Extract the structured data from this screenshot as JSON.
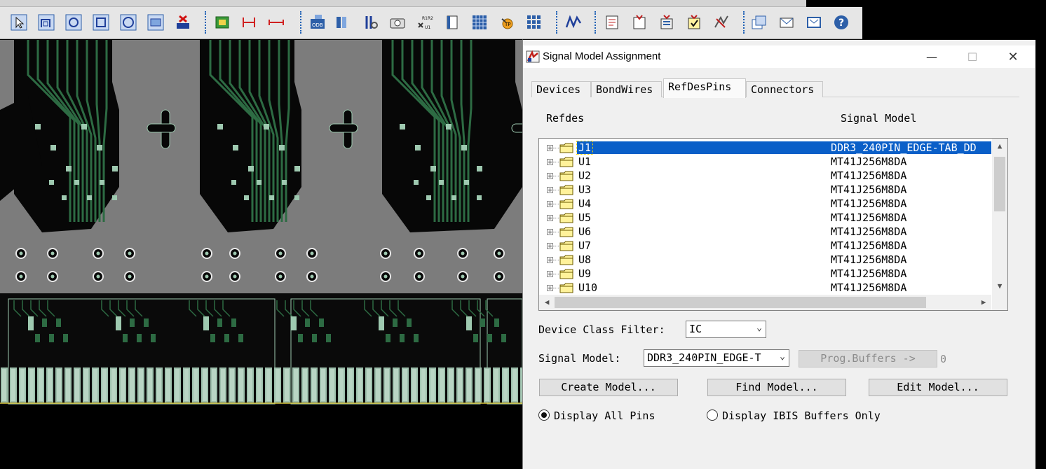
{
  "toolbar": {
    "icons": [
      "select-icon",
      "route-icon",
      "arc-icon",
      "rectangle-icon",
      "circle-icon",
      "shape-icon",
      "delete-icon",
      "component-icon",
      "dimension-icon",
      "measure-icon",
      "odb-export-icon",
      "library-icon",
      "probe-icon",
      "camera-icon",
      "refdes-rename-icon",
      "book-icon",
      "grid-icon",
      "tp-icon",
      "array-icon",
      "waveform-icon",
      "report-icon",
      "layer-icon",
      "stack-icon",
      "check-icon",
      "wire-icon",
      "windows-icon",
      "envelope-icon",
      "mail-icon",
      "help-icon"
    ]
  },
  "dialog": {
    "title": "Signal Model Assignment",
    "tabs": [
      "Devices",
      "BondWires",
      "RefDesPins",
      "Connectors"
    ],
    "active_tab": "RefDesPins",
    "headers": {
      "refdes": "Refdes",
      "signal_model": "Signal Model"
    },
    "rows": [
      {
        "refdes": "J1",
        "model": "DDR3_240PIN_EDGE-TAB_DD"
      },
      {
        "refdes": "U1",
        "model": "MT41J256M8DA"
      },
      {
        "refdes": "U2",
        "model": "MT41J256M8DA"
      },
      {
        "refdes": "U3",
        "model": "MT41J256M8DA"
      },
      {
        "refdes": "U4",
        "model": "MT41J256M8DA"
      },
      {
        "refdes": "U5",
        "model": "MT41J256M8DA"
      },
      {
        "refdes": "U6",
        "model": "MT41J256M8DA"
      },
      {
        "refdes": "U7",
        "model": "MT41J256M8DA"
      },
      {
        "refdes": "U8",
        "model": "MT41J256M8DA"
      },
      {
        "refdes": "U9",
        "model": "MT41J256M8DA"
      },
      {
        "refdes": "U10",
        "model": "MT41J256M8DA"
      }
    ],
    "device_class_filter": {
      "label": "Device Class Filter:",
      "value": "IC"
    },
    "signal_model_field": {
      "label": "Signal Model:",
      "value": "DDR3_240PIN_EDGE-T"
    },
    "prog_buffers": {
      "label": "Prog.Buffers ->",
      "count": "0"
    },
    "buttons": {
      "create": "Create Model...",
      "find": "Find Model...",
      "edit": "Edit Model..."
    },
    "radios": {
      "all_pins": "Display All Pins",
      "ibis_only": "Display IBIS Buffers Only",
      "selected": "all_pins"
    },
    "window": {
      "minimize": "—",
      "maximize": "☐",
      "close": "✕"
    },
    "scroll": {
      "up": "▲",
      "down": "▼",
      "left": "◀",
      "right": "▶"
    }
  },
  "colors": {
    "selection": "#0a5fc8",
    "copper": "#2d6b43",
    "pad": "#9ec9b0",
    "fill": "#7c7c7c"
  }
}
